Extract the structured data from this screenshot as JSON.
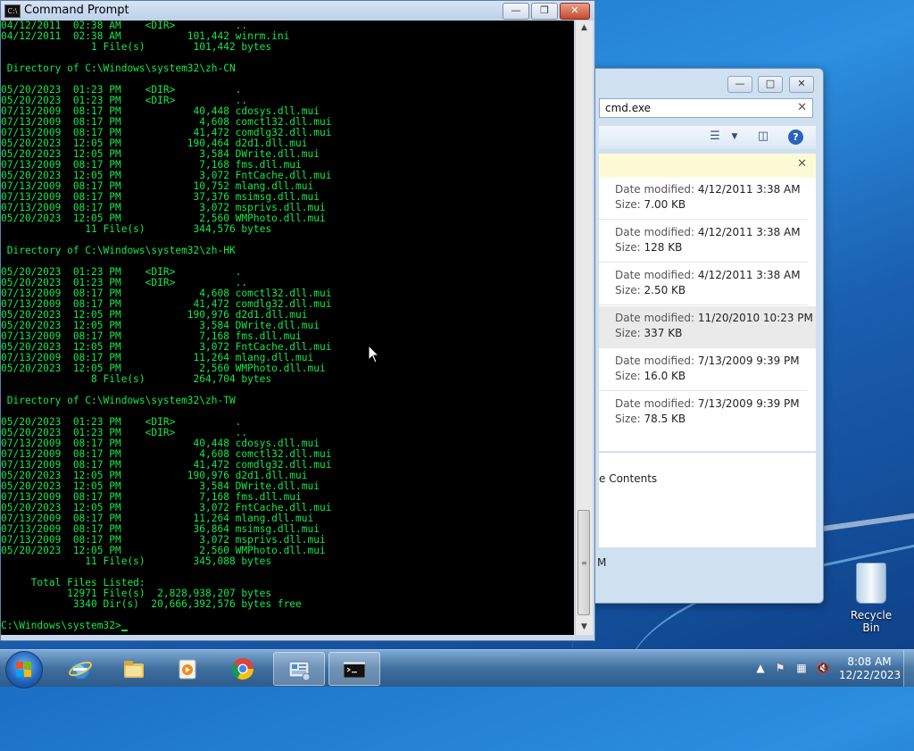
{
  "cmd": {
    "title": "Command Prompt",
    "lines": [
      "04/12/2011  02:38 AM    <DIR>          ..",
      "04/12/2011  02:38 AM           101,442 winrm.ini",
      "               1 File(s)        101,442 bytes",
      "",
      " Directory of C:\\Windows\\system32\\zh-CN",
      "",
      "05/20/2023  01:23 PM    <DIR>          .",
      "05/20/2023  01:23 PM    <DIR>          ..",
      "07/13/2009  08:17 PM            40,448 cdosys.dll.mui",
      "07/13/2009  08:17 PM             4,608 comctl32.dll.mui",
      "07/13/2009  08:17 PM            41,472 comdlg32.dll.mui",
      "05/20/2023  12:05 PM           190,464 d2d1.dll.mui",
      "05/20/2023  12:05 PM             3,584 DWrite.dll.mui",
      "07/13/2009  08:17 PM             7,168 fms.dll.mui",
      "05/20/2023  12:05 PM             3,072 FntCache.dll.mui",
      "07/13/2009  08:17 PM            10,752 mlang.dll.mui",
      "07/13/2009  08:17 PM            37,376 msimsg.dll.mui",
      "07/13/2009  08:17 PM             3,072 msprivs.dll.mui",
      "05/20/2023  12:05 PM             2,560 WMPhoto.dll.mui",
      "              11 File(s)        344,576 bytes",
      "",
      " Directory of C:\\Windows\\system32\\zh-HK",
      "",
      "05/20/2023  01:23 PM    <DIR>          .",
      "05/20/2023  01:23 PM    <DIR>          ..",
      "07/13/2009  08:17 PM             4,608 comctl32.dll.mui",
      "07/13/2009  08:17 PM            41,472 comdlg32.dll.mui",
      "05/20/2023  12:05 PM           190,976 d2d1.dll.mui",
      "05/20/2023  12:05 PM             3,584 DWrite.dll.mui",
      "07/13/2009  08:17 PM             7,168 fms.dll.mui",
      "05/20/2023  12:05 PM             3,072 FntCache.dll.mui",
      "07/13/2009  08:17 PM            11,264 mlang.dll.mui",
      "05/20/2023  12:05 PM             2,560 WMPhoto.dll.mui",
      "               8 File(s)        264,704 bytes",
      "",
      " Directory of C:\\Windows\\system32\\zh-TW",
      "",
      "05/20/2023  01:23 PM    <DIR>          .",
      "05/20/2023  01:23 PM    <DIR>          ..",
      "07/13/2009  08:17 PM            40,448 cdosys.dll.mui",
      "07/13/2009  08:17 PM             4,608 comctl32.dll.mui",
      "07/13/2009  08:17 PM            41,472 comdlg32.dll.mui",
      "05/20/2023  12:05 PM           190,976 d2d1.dll.mui",
      "05/20/2023  12:05 PM             3,584 DWrite.dll.mui",
      "07/13/2009  08:17 PM             7,168 fms.dll.mui",
      "05/20/2023  12:05 PM             3,072 FntCache.dll.mui",
      "07/13/2009  08:17 PM            11,264 mlang.dll.mui",
      "07/13/2009  08:17 PM            36,864 msimsg.dll.mui",
      "07/13/2009  08:17 PM             3,072 msprivs.dll.mui",
      "05/20/2023  12:05 PM             2,560 WMPhoto.dll.mui",
      "              11 File(s)        345,088 bytes",
      "",
      "     Total Files Listed:",
      "           12971 File(s)  2,828,938,207 bytes",
      "            3340 Dir(s)  20,666,392,576 bytes free",
      "",
      "C:\\Windows\\system32>"
    ],
    "text_color": "#16e84a"
  },
  "explorer": {
    "search_value": "cmd.exe",
    "items": [
      {
        "date_label": "Date modified:",
        "date": "4/12/2011 3:38 AM",
        "size_label": "Size:",
        "size": "7.00 KB"
      },
      {
        "date_label": "Date modified:",
        "date": "4/12/2011 3:38 AM",
        "size_label": "Size:",
        "size": "128 KB"
      },
      {
        "date_label": "Date modified:",
        "date": "4/12/2011 3:38 AM",
        "size_label": "Size:",
        "size": "2.50 KB"
      },
      {
        "date_label": "Date modified:",
        "date": "11/20/2010 10:23 PM",
        "size_label": "Size:",
        "size": "337 KB"
      },
      {
        "date_label": "Date modified:",
        "date": "7/13/2009 9:39 PM",
        "size_label": "Size:",
        "size": "16.0 KB"
      },
      {
        "date_label": "Date modified:",
        "date": "7/13/2009 9:39 PM",
        "size_label": "Size:",
        "size": "78.5 KB"
      }
    ],
    "partial_text": "e Contents",
    "partial_text_2": "M"
  },
  "desktop": {
    "recycle_bin_label": "Recycle Bin"
  },
  "taskbar": {
    "time": "8:08 AM",
    "date": "12/22/2023"
  }
}
